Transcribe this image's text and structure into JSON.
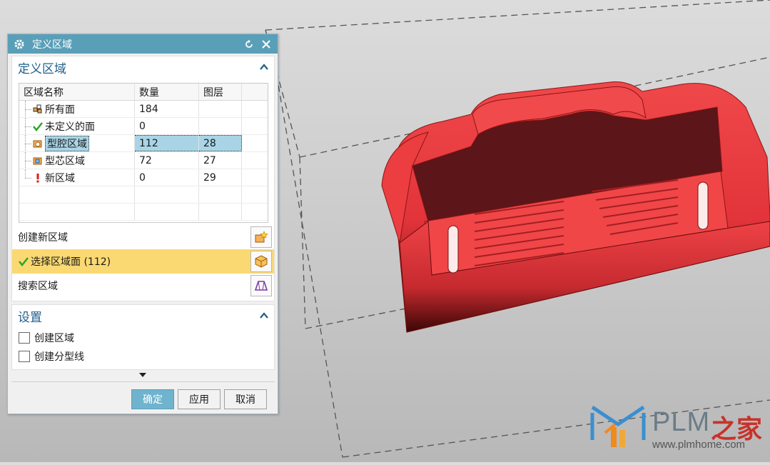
{
  "dialog": {
    "title": "定义区域",
    "icons": {
      "settings": "gear-icon",
      "reset": "reset-icon",
      "close": "close-icon"
    }
  },
  "section_define": {
    "title": "定义区域",
    "table": {
      "headers": [
        "区域名称",
        "数量",
        "图层"
      ],
      "rows": [
        {
          "name": "所有面",
          "count": "184",
          "layer": "",
          "icon": "all-faces-icon"
        },
        {
          "name": "未定义的面",
          "count": "0",
          "layer": "",
          "icon": "green-check-icon"
        },
        {
          "name": "型腔区域",
          "count": "112",
          "layer": "28",
          "icon": "cavity-region-icon",
          "selected": true
        },
        {
          "name": "型芯区域",
          "count": "72",
          "layer": "27",
          "icon": "core-region-icon"
        },
        {
          "name": "新区域",
          "count": "0",
          "layer": "29",
          "icon": "exclamation-icon"
        }
      ]
    },
    "create_region_label": "创建新区域",
    "select_faces_label": "选择区域面 (112)",
    "search_region_label": "搜索区域"
  },
  "section_settings": {
    "title": "设置",
    "create_region_checkbox": "创建区域",
    "create_parting_checkbox": "创建分型线"
  },
  "buttons": {
    "ok": "确定",
    "apply": "应用",
    "cancel": "取消"
  },
  "watermark": {
    "brand": "PLM",
    "brand_cn": "之家",
    "url": "www.plmhome.com"
  },
  "colors": {
    "accent": "#5a9fb8",
    "highlight": "#fbd972",
    "model": "#e8373a"
  }
}
